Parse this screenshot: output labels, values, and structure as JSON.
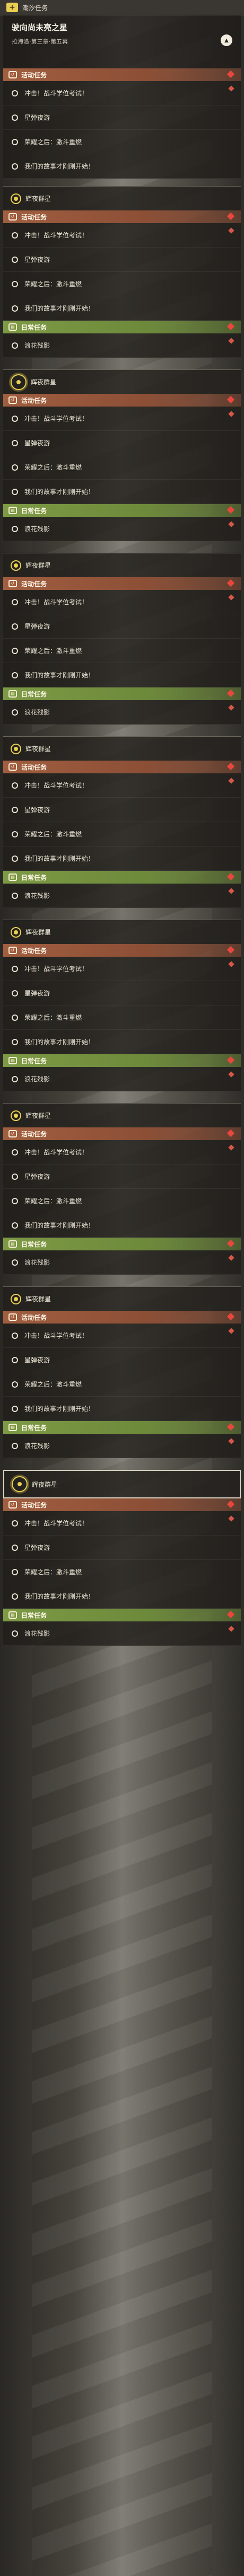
{
  "header": {
    "tab_label": "潮汐任务",
    "current_title": "驶向尚未亮之星",
    "current_subtitle": "拉海洛·第三章·第五幕"
  },
  "block_label": "辉夜群星",
  "event_section": "活动任务",
  "daily_section": "日常任务",
  "event_tasks": [
    "冲击！战斗学位考试！",
    "星弹夜游",
    "荣耀之后：激斗重燃",
    "我们的故事才刚刚开始！"
  ],
  "daily_tasks": [
    "浪花残影"
  ],
  "colors": {
    "accent_yellow": "#e9cf52",
    "event_red": "#a15e40",
    "daily_green": "#7d9a45",
    "alert_red": "#e9473d"
  }
}
